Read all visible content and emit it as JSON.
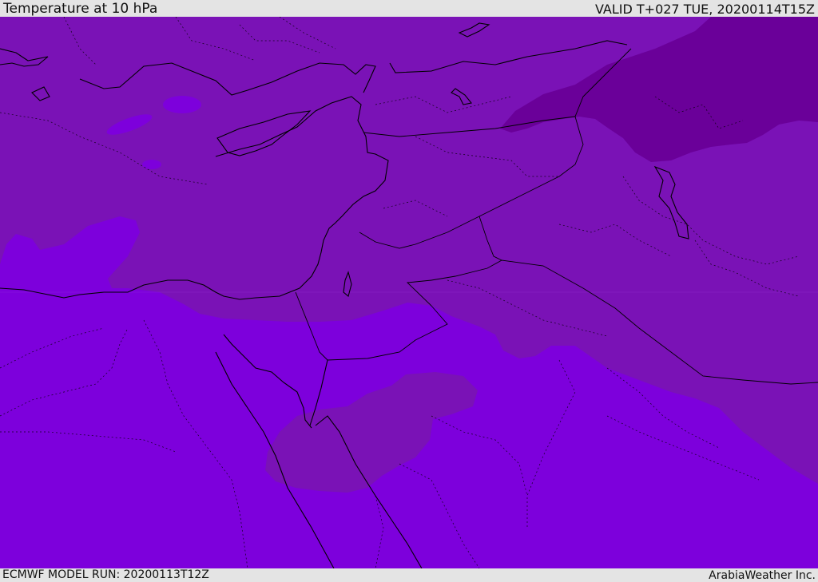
{
  "header": {
    "title": "Temperature at 10 hPa",
    "valid_time": "VALID T+027 TUE, 20200114T15Z"
  },
  "footer": {
    "model_run": "ECMWF MODEL RUN: 20200113T12Z",
    "credit": "ArabiaWeather Inc."
  },
  "map": {
    "variable": "temperature",
    "level": "10 hPa",
    "region": "Eastern Mediterranean / Middle East",
    "colors": {
      "warmest_band": "#7d00dc",
      "middle_band": "#7a12b6",
      "coldest_band": "#6a0099",
      "coastline": "#000000",
      "borders": "#000000"
    }
  }
}
